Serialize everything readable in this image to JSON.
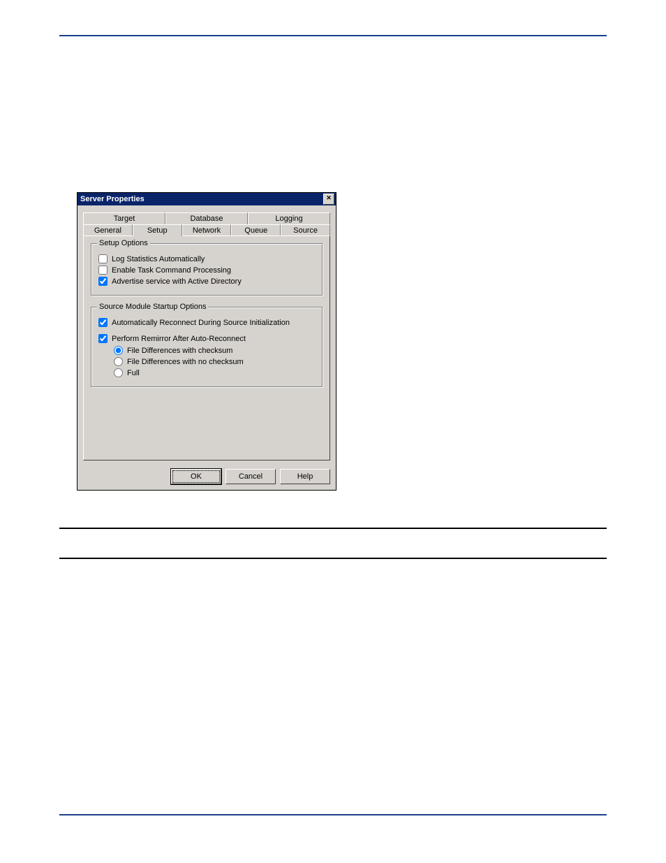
{
  "dialog": {
    "title": "Server Properties",
    "close_label": "Close"
  },
  "tabs": {
    "back_row": [
      "Target",
      "Database",
      "Logging"
    ],
    "front_row": [
      "General",
      "Setup",
      "Network",
      "Queue",
      "Source"
    ],
    "active": "Setup"
  },
  "setup_options": {
    "group_title": "Setup Options",
    "items": [
      {
        "label": "Log Statistics Automatically",
        "checked": false
      },
      {
        "label": "Enable Task Command Processing",
        "checked": false
      },
      {
        "label": "Advertise service with Active Directory",
        "checked": true
      }
    ]
  },
  "source_module": {
    "group_title": "Source Module Startup Options",
    "auto_reconnect": {
      "label": "Automatically Reconnect During Source Initialization",
      "checked": true
    },
    "perform_remirror": {
      "label": "Perform Remirror After Auto-Reconnect",
      "checked": true
    },
    "remirror_options": [
      {
        "label": "File Differences with checksum",
        "selected": true
      },
      {
        "label": "File Differences with no checksum",
        "selected": false
      },
      {
        "label": "Full",
        "selected": false
      }
    ]
  },
  "buttons": {
    "ok": "OK",
    "cancel": "Cancel",
    "help": "Help"
  }
}
